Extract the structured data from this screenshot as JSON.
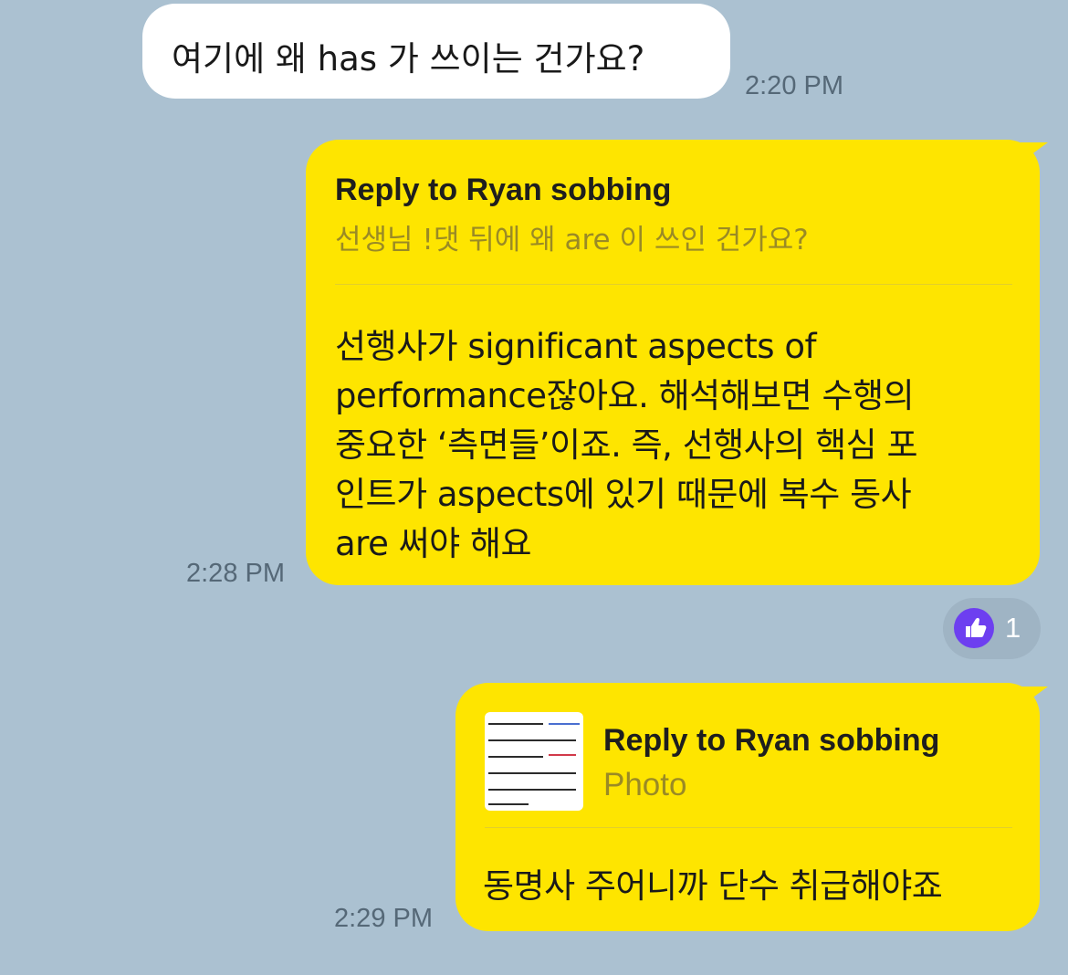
{
  "messages": {
    "incoming_1": {
      "text": "여기에 왜 has 가 쓰이는 건가요?",
      "time": "2:20 PM"
    },
    "outgoing_1": {
      "reply_title": "Reply to Ryan sobbing",
      "reply_quote": "선생님 !댓 뒤에 왜 are 이 쓰인 건가요?",
      "body_lines": [
        "선행사가 significant aspects of",
        "performance잖아요. 해석해보면 수행의",
        "중요한 ‘측면들’이죠. 즉, 선행사의 핵심 포",
        "인트가 aspects에 있기 때문에 복수 동사",
        "are 써야 해요"
      ],
      "time": "2:28 PM",
      "reaction": {
        "icon": "thumbs-up-icon",
        "count": "1",
        "color": "#6d3ff0"
      }
    },
    "outgoing_2": {
      "reply_title": "Reply to Ryan sobbing",
      "reply_quote": "Photo",
      "body": "동명사 주어니까 단수 취급해야죠",
      "time": "2:29 PM"
    }
  },
  "colors": {
    "background": "#abc1d1",
    "outgoing_bubble": "#fee500",
    "incoming_bubble": "#ffffff"
  }
}
